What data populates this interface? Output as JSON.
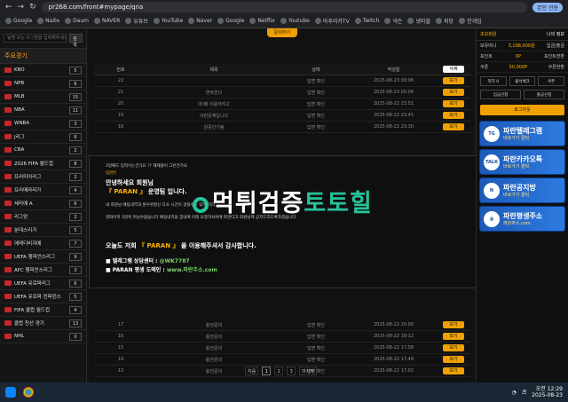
{
  "browser": {
    "url": "pr268.com/front#mypage/qna",
    "profile_label": "본인 전용",
    "bookmarks": [
      "Google",
      "Naite",
      "Daum",
      "NAVER",
      "유튜브",
      "YouTube",
      "Naver",
      "Google",
      "Netflix",
      "Youtube",
      "마푸리카TV",
      "Twitch",
      "넥슨",
      "넷마블",
      "피망",
      "한게임"
    ]
  },
  "left": {
    "search_placeholder": "팀명 또는 리그명을 입력해주세요.",
    "search_btn": "검색",
    "title": "주요경기",
    "leagues": [
      {
        "name": "KBO",
        "count": "5"
      },
      {
        "name": "NPB",
        "count": "6"
      },
      {
        "name": "MLB",
        "count": "15"
      },
      {
        "name": "NBA",
        "count": "11"
      },
      {
        "name": "WNBA",
        "count": "3"
      },
      {
        "name": "J리그",
        "count": "6"
      },
      {
        "name": "CBA",
        "count": "2"
      },
      {
        "name": "2026 FIFA 월드컵",
        "count": "8"
      },
      {
        "name": "프리미어리그",
        "count": "2"
      },
      {
        "name": "프리메라리가",
        "count": "4"
      },
      {
        "name": "세리에 A",
        "count": "6"
      },
      {
        "name": "리그앙",
        "count": "2"
      },
      {
        "name": "분데스리가",
        "count": "5"
      },
      {
        "name": "에레디비지에",
        "count": "7"
      },
      {
        "name": "UEFA 챔피언스리그",
        "count": "9"
      },
      {
        "name": "AFC 챔피언스리그",
        "count": "3"
      },
      {
        "name": "UEFA 유로파리그",
        "count": "6"
      },
      {
        "name": "UEFA 유로파 컨퍼런스",
        "count": "5"
      },
      {
        "name": "FIFA 클럽 월드컵",
        "count": "4"
      },
      {
        "name": "클럽 친선 경기",
        "count": "13"
      },
      {
        "name": "NHL",
        "count": "0"
      }
    ]
  },
  "main": {
    "top_tab": "문의하기",
    "headers": [
      "번호",
      "제목",
      "상태",
      "작성일",
      "삭제"
    ],
    "rows_top": [
      {
        "no": "22",
        "title": "",
        "status": "답변 확인",
        "date": "2025-08-23 00:06",
        "btn": "보기"
      },
      {
        "no": "21",
        "title": "연락한다",
        "status": "답변 확인",
        "date": "2025-08-23 00:06",
        "btn": "보기"
      },
      {
        "no": "20",
        "title": "마/패 이용하려고",
        "status": "답변 확인",
        "date": "2025-08-22 23:51",
        "btn": "보기"
      },
      {
        "no": "19",
        "title": "이런문제입니다",
        "status": "답변 확인",
        "date": "2025-08-22 23:45",
        "btn": "보기"
      },
      {
        "no": "18",
        "title": "원문인기됨",
        "status": "답변 확인",
        "date": "2025-08-22 23:30",
        "btn": "보기"
      }
    ],
    "popup": {
      "line1": "3일째도 입력이는건가요 ?? 해제풀어 그런건가요",
      "tag": "[답변]",
      "greeting": "안녕하세요 회원님",
      "running_pre": "『 PARAN 』",
      "running_post": " 운영팀 입니다.",
      "line2": "내 회원님 베팅내역과 원수위정신 다소 시간이 걸릴수도 있어 미리",
      "line3": "영화어져 3일씩 머님수없습니다 베팅내역을 꿈내에 아래 요청하셔서에 따면다고 회원님께 공지드리도록하겠습니다",
      "thanks_pre": "오늘도 저희 ",
      "thanks_brand": "『 PARAN 』",
      "thanks_post": " 을 이용해주셔서 감사합니다.",
      "tg_label": "■ 텔레그램 상담센터 : ",
      "tg_value": "@WK7787",
      "domain_label": "■ PARAN 평생 도메인 : ",
      "domain_value": "www.파란주소.com",
      "watermark_a": "먹튀검증",
      "watermark_b": "토토힐"
    },
    "rows_bottom": [
      {
        "no": "17",
        "title": "충전문의",
        "status": "답변 확인",
        "date": "2025-08-22 20:00",
        "btn": "보기"
      },
      {
        "no": "16",
        "title": "충전문의",
        "status": "답변 확인",
        "date": "2025-08-22 18:12",
        "btn": "보기"
      },
      {
        "no": "15",
        "title": "충전문의",
        "status": "답변 확인",
        "date": "2025-08-22 17:58",
        "btn": "보기"
      },
      {
        "no": "14",
        "title": "충전문의",
        "status": "답변 확인",
        "date": "2025-08-22 17:48",
        "btn": "보기"
      },
      {
        "no": "13",
        "title": "충전문의",
        "status": "답변 확인",
        "date": "2025-08-22 17:02",
        "btn": "보기"
      }
    ],
    "pager": [
      "처음",
      "1",
      "2",
      "3",
      "마지막"
    ]
  },
  "right": {
    "level": "초보회원",
    "mypage": "나의 정보",
    "cash_label": "보유머니",
    "cash_value": "3,198,000원",
    "cash_btn": "입금/출금",
    "point_label": "포인트",
    "point_value": "0P",
    "point_btn": "포인트전환",
    "coupon_label": "쿠폰",
    "coupon_value": "50,000P",
    "coupon_btn": "쿠폰전환",
    "grid": [
      "쪽지 0",
      "출석체크",
      "쿠폰"
    ],
    "grid2": [
      "입금신청",
      "출금신청"
    ],
    "logout": "로그아웃",
    "banners": [
      {
        "title": "파란텔레그램",
        "sub": "바로가기 클릭",
        "icon": "TG"
      },
      {
        "title": "파란카카오톡",
        "sub": "바로가기 클릭",
        "icon": "TALK"
      },
      {
        "title": "파란공지방",
        "sub": "바로가기 클릭",
        "icon": "N"
      },
      {
        "title": "파란평생주소",
        "sub": "파란주소.com",
        "icon": "@"
      }
    ]
  },
  "taskbar": {
    "time": "오전 12:29",
    "date": "2025-08-23"
  }
}
